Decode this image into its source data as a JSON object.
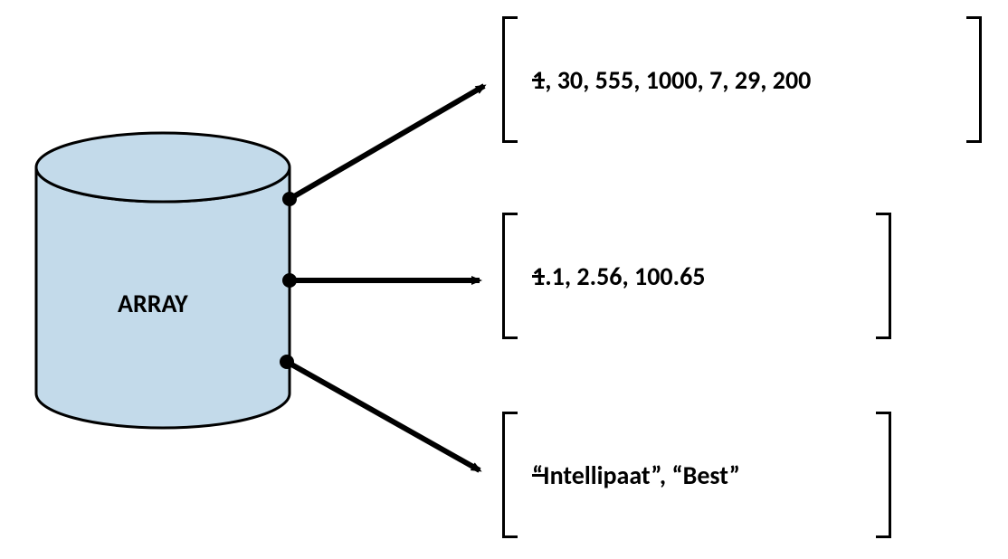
{
  "cylinder": {
    "label": "ARRAY",
    "fill": "#C3DAEA"
  },
  "examples": {
    "integers": {
      "values": [
        1,
        30,
        555,
        1000,
        7,
        29,
        200
      ],
      "display": "1, 30, 555, 1000, 7, 29, 200"
    },
    "floats": {
      "values": [
        1.1,
        2.56,
        100.65
      ],
      "display": "1.1, 2.56, 100.65"
    },
    "strings": {
      "values": [
        "Intellipaat",
        "Best"
      ],
      "display": "“Intellipaat”, “Best”"
    }
  }
}
